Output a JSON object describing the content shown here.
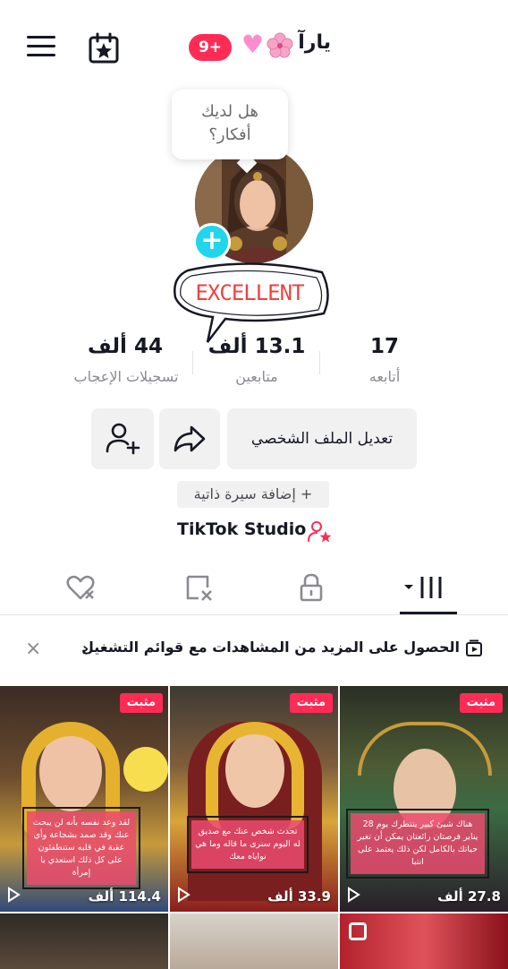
{
  "header": {
    "username": "يارآ",
    "notification_count": "9+",
    "icons": [
      "hamburger-menu-icon",
      "calendar-star-icon",
      "pink-heart-emoji",
      "cherry-blossom-emoji"
    ]
  },
  "profile": {
    "bubble_text_line1": "هل لديك",
    "bubble_text_line2": "أفكار؟",
    "sticker_text": "EXCELLENT",
    "stats": {
      "likes_value": "44 ألف",
      "likes_label": "تسجيلات الإعجاب",
      "followers_value": "13.1 ألف",
      "followers_label": "متابعين",
      "following_value": "17",
      "following_label": "أتابعه"
    },
    "edit_button": "تعديل الملف الشخصي",
    "bio_button": "+ إضافة سيرة ذاتية",
    "studio_label": "TikTok Studio"
  },
  "tabs": {
    "items": [
      "videos-grid-tab",
      "private-lock-tab",
      "reposts-tab",
      "liked-tab"
    ],
    "active": "videos-grid-tab"
  },
  "banner": {
    "text": "الحصول على المزيد من المشاهدات مع قوائم التشغيل",
    "chevron": "›",
    "close": "×"
  },
  "videos": [
    {
      "pinned": "مثبت",
      "caption": "هناك شيئ كبير ينتظرك يوم 28 يناير فرصتان رائعتان يمكن أن تغير حياتك بالكامل لكن ذلك يعتمد على انتبا",
      "views": "27.8 ألف"
    },
    {
      "pinned": "مثبت",
      "caption": "تحدث شخص عنك مع صديق له اليوم سنرى ما قاله وما هي نواياه معك",
      "views": "33.9 ألف"
    },
    {
      "pinned": "مثبت",
      "caption": "لقد وعد نفسه بأنه لن يبحث عنك وقد صمد بشجاعة وأي عقبة في قلبه ستنطفئون على كل ذلك استعدي يا إمرأة",
      "views": "114.4 ألف"
    }
  ],
  "colors": {
    "accent": "#fe2c55",
    "cyan": "#20d5ec",
    "text": "#161823",
    "muted": "#8a8b91"
  }
}
